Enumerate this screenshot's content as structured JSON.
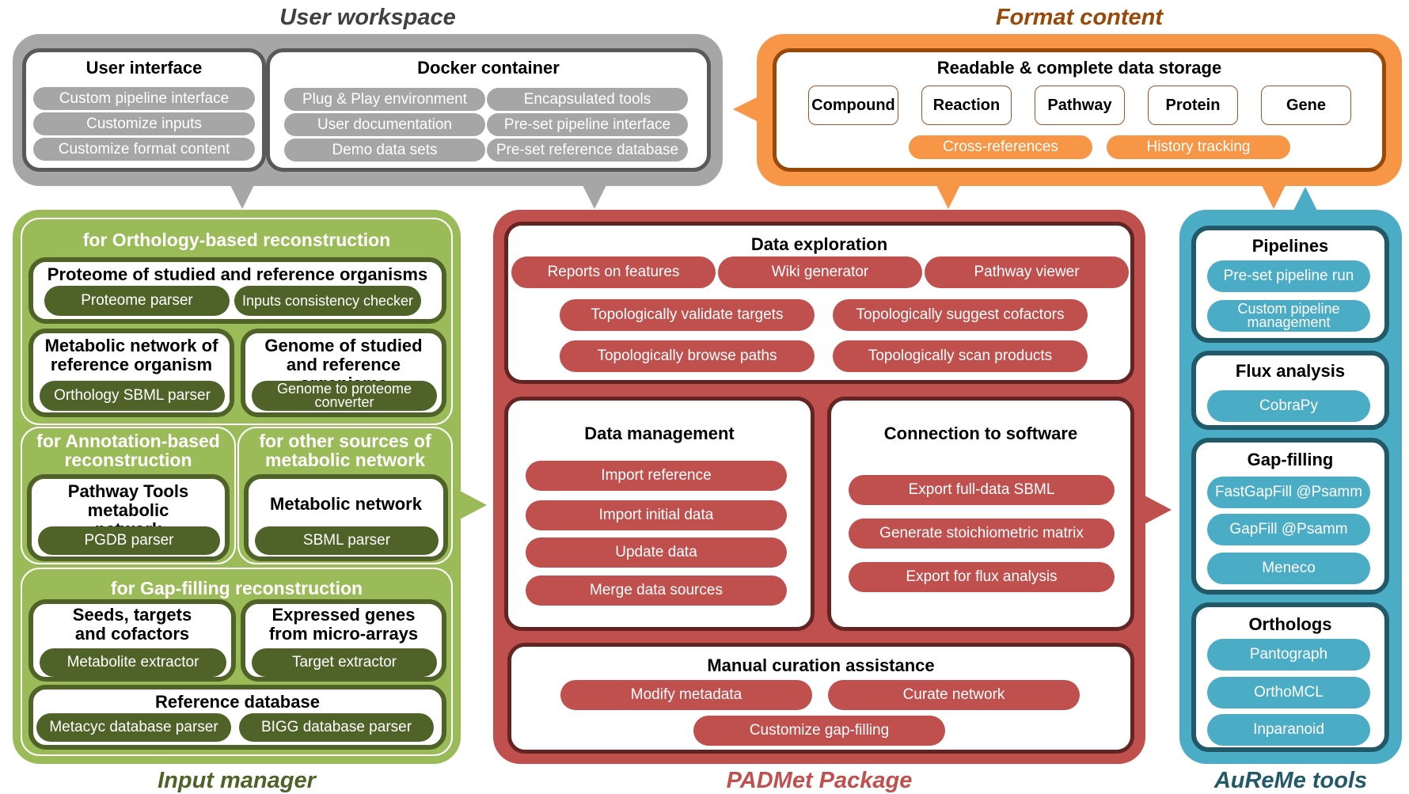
{
  "user_workspace": {
    "title": "User workspace",
    "user_interface": {
      "heading": "User interface",
      "items": [
        "Custom pipeline interface",
        "Customize inputs",
        "Customize format content"
      ]
    },
    "docker_container": {
      "heading": "Docker container",
      "items": [
        "Plug & Play environment",
        "Encapsulated  tools",
        "User documentation",
        "Pre-set pipeline interface",
        "Demo data sets",
        "Pre-set reference database"
      ]
    }
  },
  "format_content": {
    "title": "Format content",
    "heading": "Readable & complete data storage",
    "entities": [
      "Compound",
      "Reaction",
      "Pathway",
      "Protein",
      "Gene"
    ],
    "features": [
      "Cross-references",
      "History tracking"
    ]
  },
  "input_manager": {
    "title": "Input manager",
    "orthology": {
      "subtitle": "for Orthology-based reconstruction",
      "proteome": {
        "heading": "Proteome of studied and reference organisms",
        "items": [
          "Proteome parser",
          "Inputs consistency checker"
        ]
      },
      "metabolic_ref": {
        "heading": "Metabolic network of reference organism",
        "items": [
          "Orthology SBML parser"
        ]
      },
      "genome": {
        "heading": "Genome of studied and reference organisms",
        "items": [
          "Genome to proteome converter"
        ]
      }
    },
    "annotation": {
      "subtitle": "for Annotation-based reconstruction",
      "heading": "Pathway Tools metabolic network",
      "items": [
        "PGDB parser"
      ]
    },
    "other_sources": {
      "subtitle": "for other sources of metabolic network",
      "heading": "Metabolic network",
      "items": [
        "SBML parser"
      ]
    },
    "gapfilling": {
      "subtitle": "for Gap-filling reconstruction",
      "seeds": {
        "heading": "Seeds, targets and cofactors",
        "items": [
          "Metabolite extractor"
        ]
      },
      "expressed": {
        "heading": "Expressed genes from micro-arrays",
        "items": [
          "Target extractor"
        ]
      },
      "reference_db": {
        "heading": "Reference database",
        "items": [
          "Metacyc database parser",
          "BIGG database parser"
        ]
      }
    }
  },
  "padmet": {
    "title": "PADMet Package",
    "data_exploration": {
      "heading": "Data exploration",
      "items": [
        "Reports on features",
        "Wiki generator",
        "Pathway viewer",
        "Topologically validate targets",
        "Topologically suggest cofactors",
        "Topologically browse paths",
        "Topologically scan products"
      ]
    },
    "data_management": {
      "heading": "Data management",
      "items": [
        "Import reference",
        "Import initial data",
        "Update data",
        "Merge data sources"
      ]
    },
    "connection": {
      "heading": "Connection to software",
      "items": [
        "Export full-data SBML",
        "Generate stoichiometric matrix",
        "Export for flux analysis"
      ]
    },
    "manual_curation": {
      "heading": "Manual curation assistance",
      "items": [
        "Modify metadata",
        "Curate network",
        "Customize gap-filling"
      ]
    }
  },
  "aureme": {
    "title": "AuReMe tools",
    "pipelines": {
      "heading": "Pipelines",
      "items": [
        "Pre-set pipeline  run",
        "Custom pipeline management"
      ]
    },
    "flux": {
      "heading": "Flux analysis",
      "items": [
        "CobraPy"
      ]
    },
    "gapfilling": {
      "heading": "Gap-filling",
      "items": [
        "FastGapFill @Psamm",
        "GapFill @Psamm",
        "Meneco"
      ]
    },
    "orthologs": {
      "heading": "Orthologs",
      "items": [
        "Pantograph",
        "OrthoMCL",
        "Inparanoid"
      ]
    }
  },
  "colors": {
    "gray": "#a6a6a6",
    "gray_dark": "#595959",
    "orange": "#f79646",
    "orange_dark": "#984807",
    "green": "#9bbb59",
    "green_dark": "#4f6228",
    "red": "#c0504d",
    "red_dark": "#632523",
    "blue": "#4bacc6",
    "blue_dark": "#215968"
  }
}
